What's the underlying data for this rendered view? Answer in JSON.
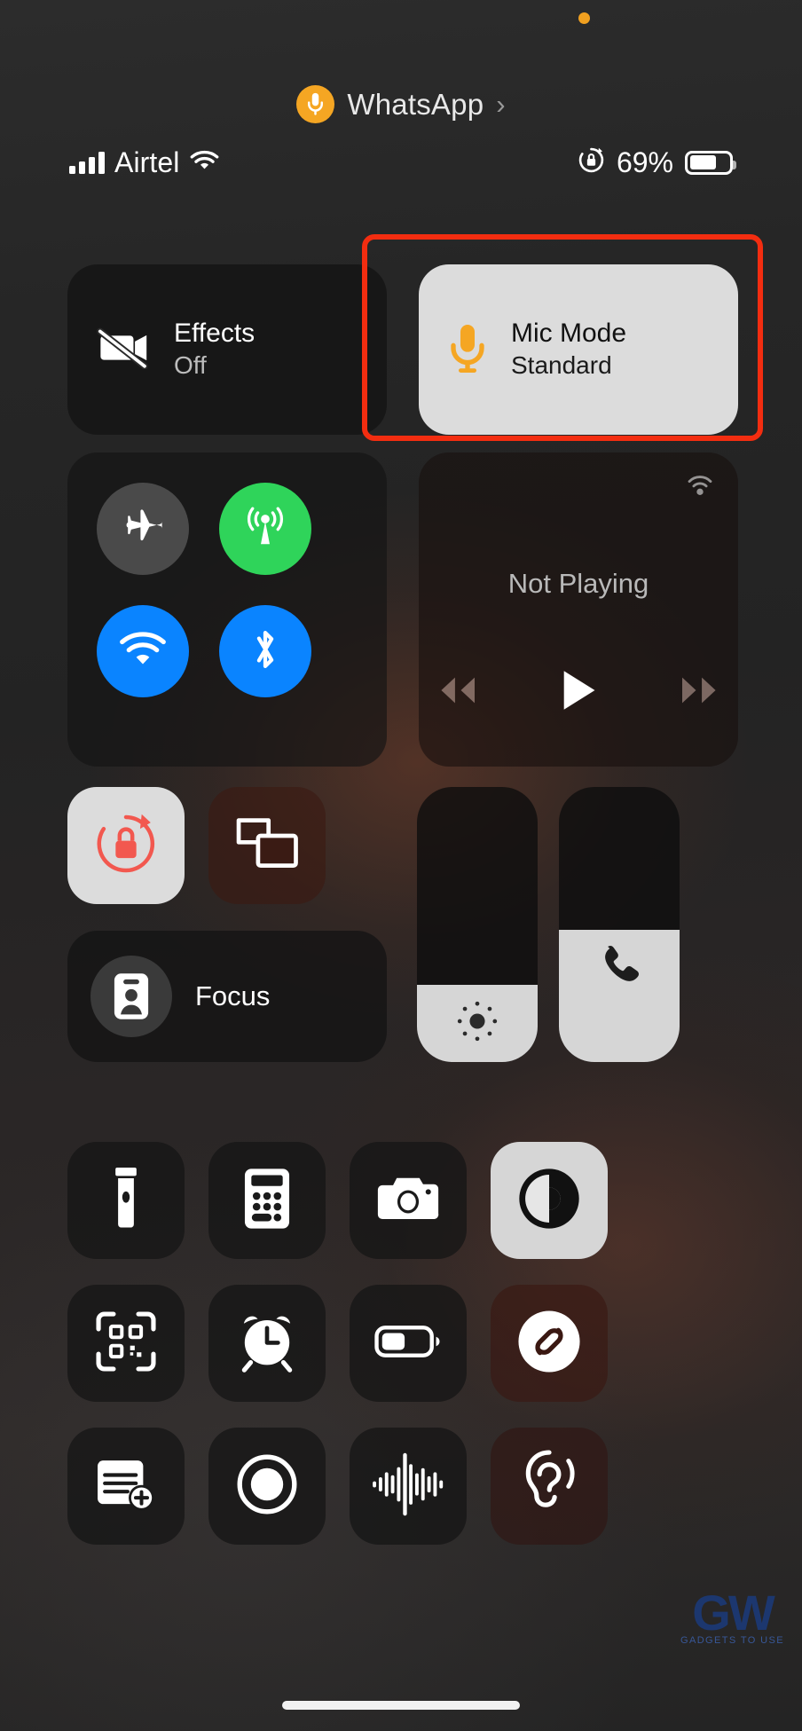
{
  "screen": {
    "device": "iphone-control-center",
    "accent_orange": "#f5a623",
    "highlight_color": "#f32d10"
  },
  "mic_attribution": {
    "app_name": "WhatsApp",
    "icon": "microphone-icon",
    "chevron": "›",
    "dot_color": "#f0a020"
  },
  "status_bar": {
    "carrier": "Airtel",
    "signal_icon": "cellular-bars-icon",
    "wifi_icon": "wifi-icon",
    "rotation_lock_icon": "rotation-lock-icon",
    "battery_percent": "69%",
    "battery_level": 69,
    "battery_icon": "battery-icon"
  },
  "tiles": {
    "effects": {
      "title": "Effects",
      "subtitle": "Off",
      "icon": "video-effects-off-icon",
      "state": "off"
    },
    "mic_mode": {
      "title": "Mic Mode",
      "subtitle": "Standard",
      "icon": "microphone-icon",
      "state": "active",
      "highlighted": true
    }
  },
  "connectivity": {
    "airplane_mode": {
      "name": "Airplane Mode",
      "icon": "airplane-icon",
      "state": "off"
    },
    "cellular_data": {
      "name": "Cellular Data",
      "icon": "cellular-antenna-icon",
      "state": "on"
    },
    "wifi": {
      "name": "Wi-Fi",
      "icon": "wifi-icon",
      "state": "on"
    },
    "bluetooth": {
      "name": "Bluetooth",
      "icon": "bluetooth-icon",
      "state": "on"
    }
  },
  "media": {
    "status": "Not Playing",
    "airplay_icon": "airplay-audio-icon",
    "rewind_icon": "rewind-icon",
    "play_icon": "play-icon",
    "forward_icon": "fast-forward-icon",
    "rewind_enabled": false,
    "forward_enabled": false
  },
  "controls": {
    "rotation_lock": {
      "name": "Rotation Lock",
      "icon": "rotation-lock-icon",
      "state": "on"
    },
    "screen_mirroring": {
      "name": "Screen Mirroring",
      "icon": "screen-mirroring-icon",
      "state": "off"
    },
    "focus": {
      "name": "Focus",
      "label": "Focus",
      "icon": "focus-person-badge-icon",
      "state": "off"
    }
  },
  "sliders": {
    "brightness": {
      "name": "Brightness",
      "icon": "brightness-sun-icon",
      "value_percent": 28
    },
    "volume": {
      "name": "Volume",
      "icon": "phone-handset-icon",
      "value_percent": 48
    }
  },
  "utility_grid": [
    {
      "name": "Flashlight",
      "icon": "flashlight-icon",
      "state": "off"
    },
    {
      "name": "Calculator",
      "icon": "calculator-icon",
      "state": "off"
    },
    {
      "name": "Camera",
      "icon": "camera-icon",
      "state": "off"
    },
    {
      "name": "Dark Mode",
      "icon": "dark-mode-icon",
      "state": "on"
    },
    {
      "name": "Code Scanner",
      "icon": "qr-code-scanner-icon",
      "state": "off"
    },
    {
      "name": "Alarm",
      "icon": "alarm-clock-icon",
      "state": "off"
    },
    {
      "name": "Low Power Mode",
      "icon": "low-power-battery-icon",
      "state": "off"
    },
    {
      "name": "Music Recognition",
      "icon": "shazam-icon",
      "state": "off"
    },
    {
      "name": "Notes",
      "icon": "quick-note-icon",
      "state": "off"
    },
    {
      "name": "Screen Recording",
      "icon": "screen-record-icon",
      "state": "off"
    },
    {
      "name": "Voice Memos",
      "icon": "sound-waveform-icon",
      "state": "off"
    },
    {
      "name": "Hearing",
      "icon": "ear-hearing-icon",
      "state": "off"
    }
  ],
  "watermark": {
    "mark": "GW",
    "subtext": "GADGETS TO USE"
  }
}
